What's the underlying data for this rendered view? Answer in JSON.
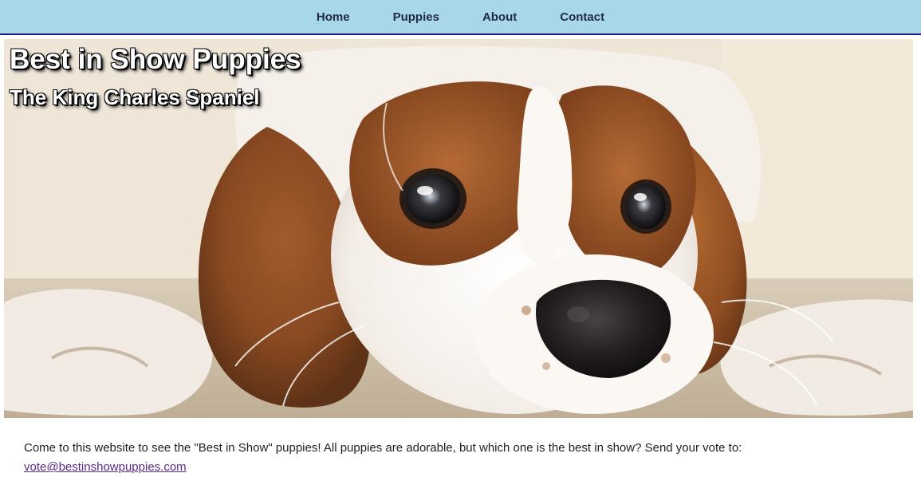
{
  "nav": {
    "items": [
      "Home",
      "Puppies",
      "About",
      "Contact"
    ]
  },
  "hero": {
    "title": "Best in Show Puppies",
    "subtitle": "The King Charles Spaniel",
    "image_subject": "cavalier-king-charles-spaniel-puppy-photo"
  },
  "content": {
    "intro": "Come to this website to see the \"Best in Show\" puppies! All puppies are adorable, but which one is the best in show? Send your vote to:",
    "email": "vote@bestinshowpuppies.com"
  },
  "colors": {
    "nav_bg": "#a8d8e8",
    "nav_border": "#1a1a8a",
    "link": "#5a2a8a"
  }
}
